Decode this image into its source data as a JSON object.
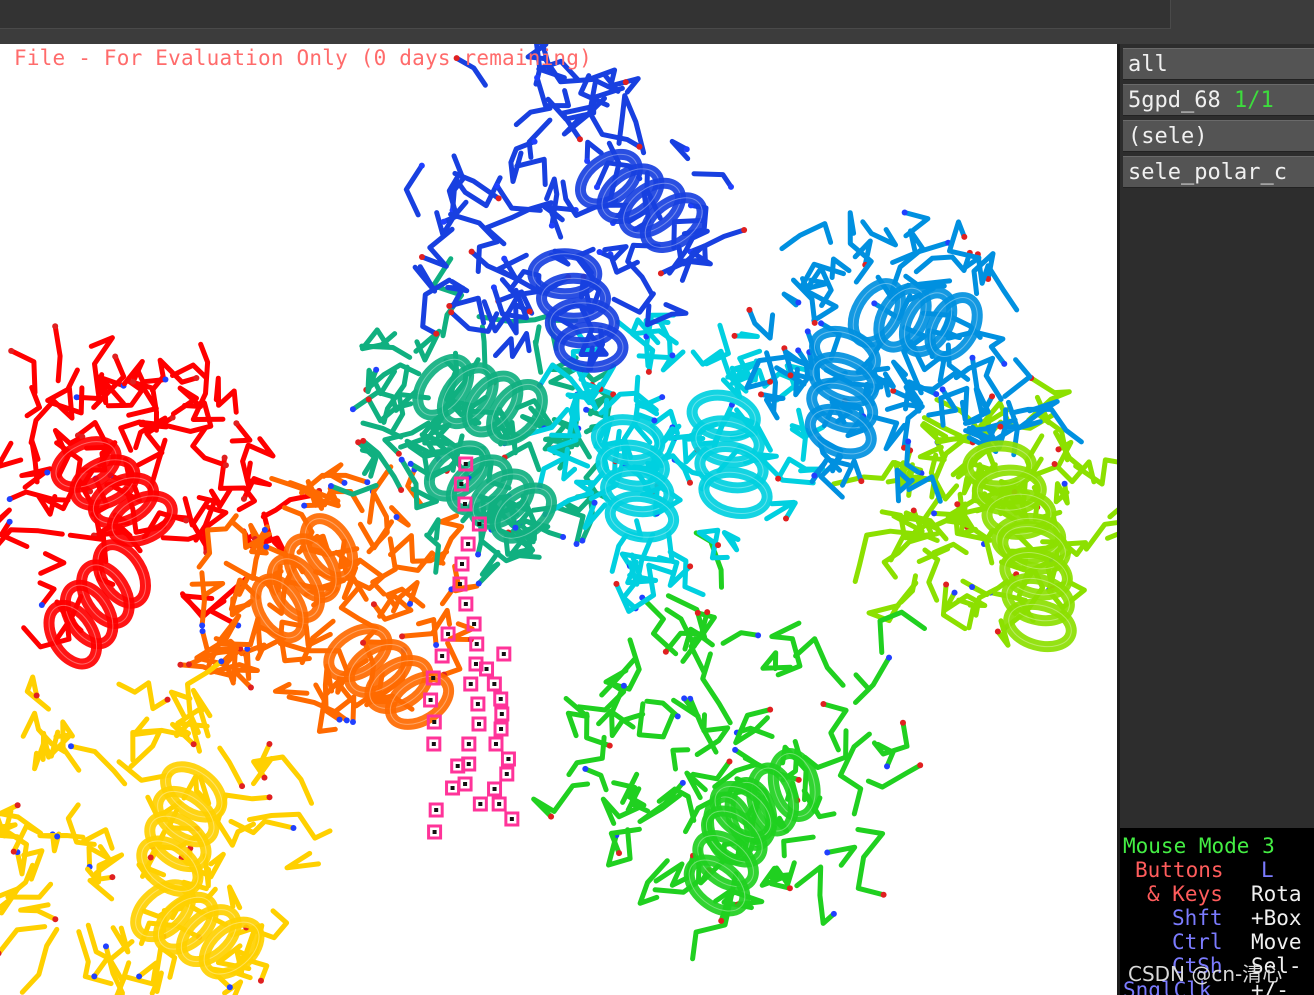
{
  "topbar": {
    "command_line": ""
  },
  "viewport": {
    "banner": "File - For Evaluation Only (0 days remaining)"
  },
  "object_panel": {
    "rows": [
      {
        "name": "all",
        "count": ""
      },
      {
        "name": "5gpd_68",
        "count": "1/1"
      },
      {
        "name": "(sele)",
        "count": ""
      },
      {
        "name": "sele_polar_c",
        "count": ""
      }
    ]
  },
  "mouse_mode": {
    "title": "Mouse Mode 3",
    "buttons_label": "Buttons",
    "buttons_value": "L",
    "keys_label": "& Keys",
    "keys_value": "Rota",
    "shift_label": "Shft",
    "shift_value": "+Box",
    "ctrl_label": "Ctrl",
    "ctrl_value": "Move",
    "ctsh_label": "CtSh",
    "ctsh_value": "Sel-",
    "snglclk_label": "SnglClk",
    "snglclk_value": "+/-"
  },
  "watermark": "CSDN @cn-清心",
  "colors": {
    "banner": "#ff6b6b",
    "selection": "#ff3399",
    "rainbow": [
      "#ff0000",
      "#ff6a00",
      "#ffd000",
      "#8ce000",
      "#20d020",
      "#10b080",
      "#00d0e0",
      "#0090e0",
      "#1840e0"
    ]
  }
}
